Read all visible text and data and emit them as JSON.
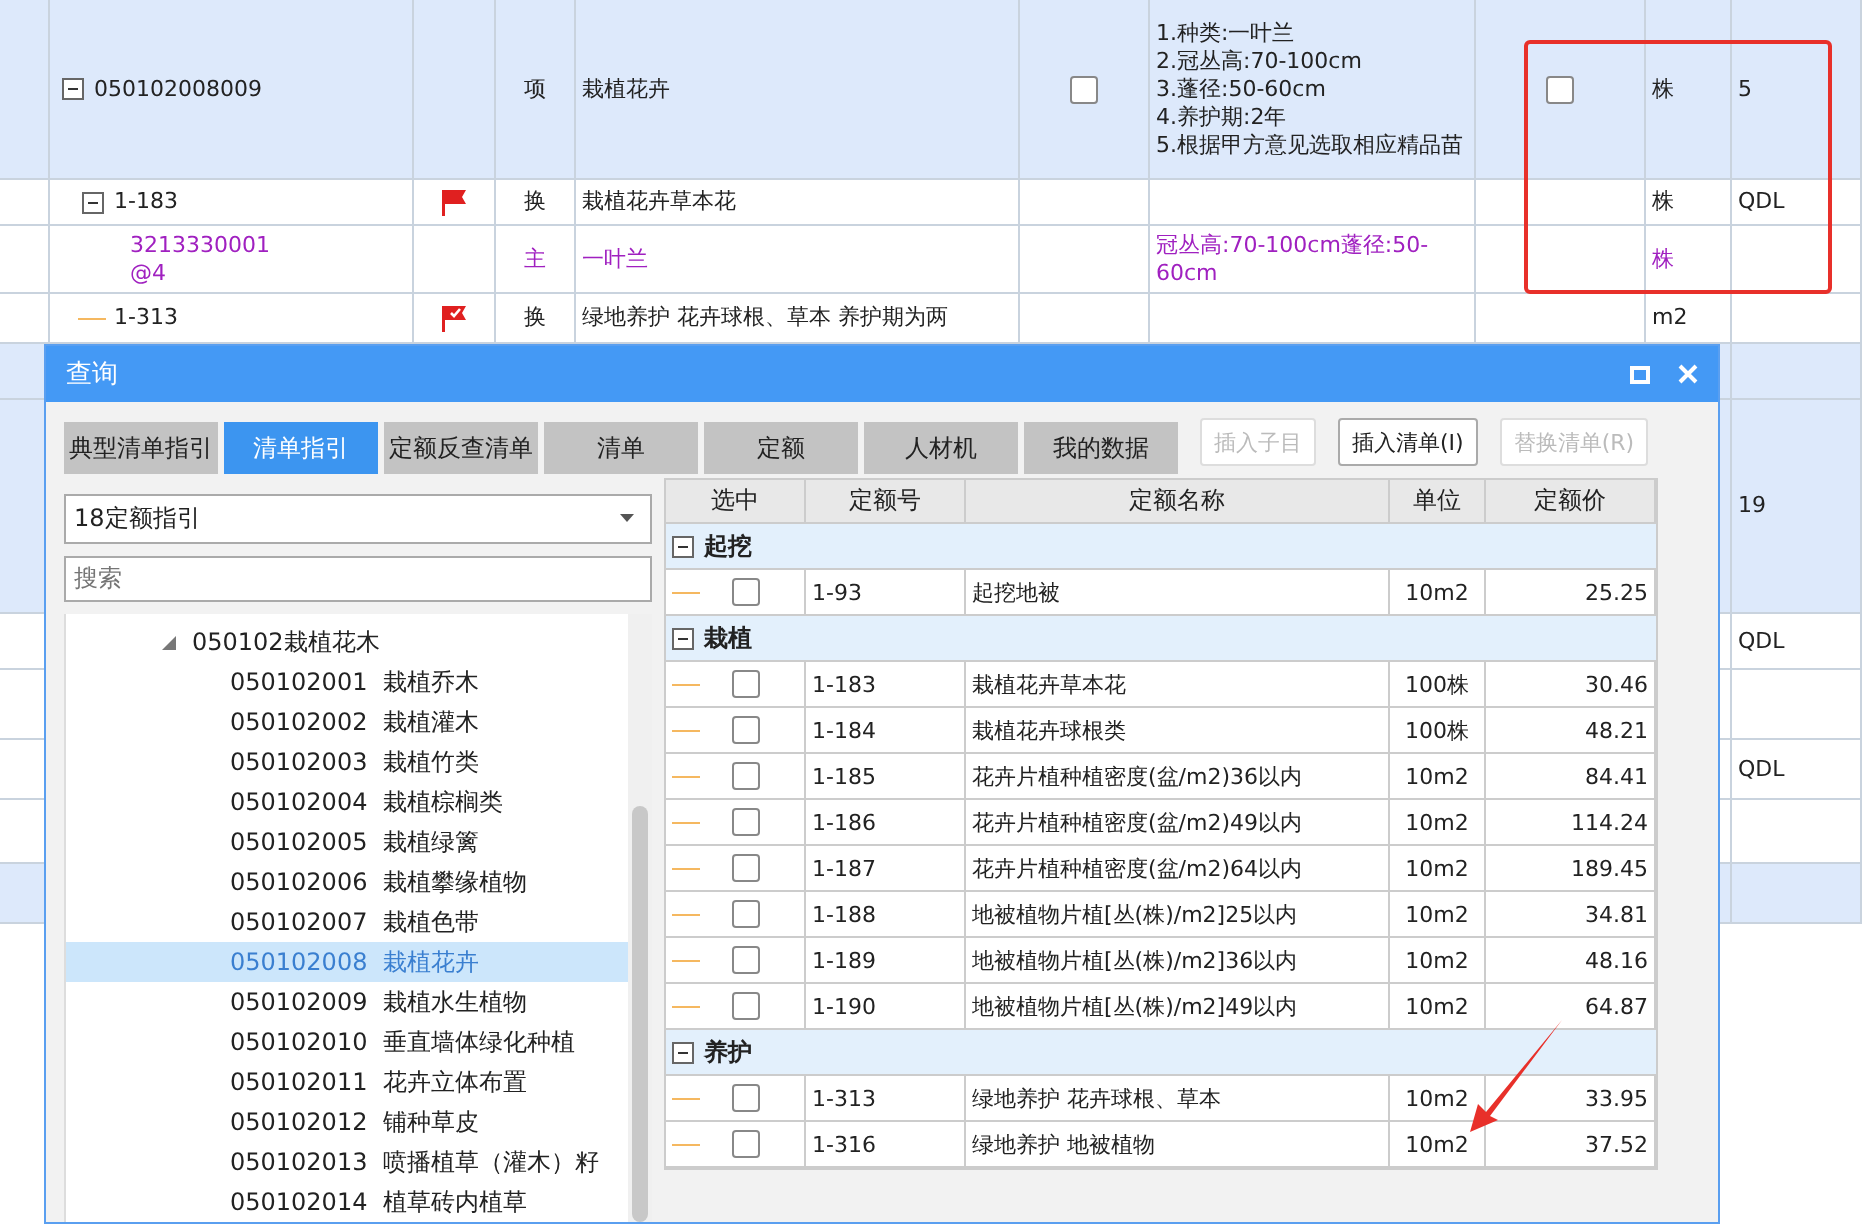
{
  "sheet": {
    "rows": [
      {
        "kind": "item",
        "code": "050102008009",
        "expanded": true,
        "type": "项",
        "name": "栽植花卉",
        "checked": false,
        "features": [
          "1.种类:一叶兰",
          "2.冠丛高:70-100cm",
          "3.蓬径:50-60cm",
          "4.养护期:2年",
          "5.根据甲方意见选取相应精品苗"
        ],
        "checked2": false,
        "unit": "株",
        "qty": "5"
      },
      {
        "kind": "sub",
        "code": "1-183",
        "expanded": true,
        "flagged": true,
        "flag_checked": false,
        "type": "换",
        "name": "栽植花卉草本花",
        "features": [],
        "unit": "株",
        "qty": "QDL"
      },
      {
        "kind": "main",
        "code": "3213330001@4",
        "type": "主",
        "name": "一叶兰",
        "features": [
          "冠丛高:70-100cm蓬径:50-60cm"
        ],
        "unit": "株",
        "qty": ""
      },
      {
        "kind": "sub",
        "code": "1-313",
        "flagged": true,
        "flag_checked": true,
        "type": "换",
        "name": "绿地养护 花卉球根、草本  养护期为两",
        "features": [],
        "unit": "m2",
        "qty": ""
      }
    ],
    "side_rows": [
      {
        "highlighted": true
      },
      {
        "value": "19",
        "highlighted": true
      },
      {
        "value": "QDL",
        "highlighted": false
      },
      {
        "highlighted": false
      },
      {
        "value": "QDL",
        "highlighted": false
      },
      {
        "highlighted": false
      },
      {
        "highlighted": true
      }
    ]
  },
  "dialog": {
    "title": "查询",
    "tabs": [
      {
        "label": "典型清单指引",
        "selected": false
      },
      {
        "label": "清单指引",
        "selected": true
      },
      {
        "label": "定额反查清单",
        "selected": false
      },
      {
        "label": "清单",
        "selected": false
      },
      {
        "label": "定额",
        "selected": false
      },
      {
        "label": "人材机",
        "selected": false
      },
      {
        "label": "我的数据",
        "selected": false
      }
    ],
    "buttons": [
      {
        "label": "插入子目",
        "disabled": true
      },
      {
        "label": "插入清单(I)",
        "disabled": false
      },
      {
        "label": "替换清单(R)",
        "disabled": true
      }
    ],
    "dropdown": "18定额指引",
    "search": {
      "placeholder": "搜索"
    },
    "tree": {
      "label": "050102栽植花木",
      "expanded": true,
      "children": [
        {
          "code": "050102001",
          "name": "栽植乔木",
          "selected": false
        },
        {
          "code": "050102002",
          "name": "栽植灌木",
          "selected": false
        },
        {
          "code": "050102003",
          "name": "栽植竹类",
          "selected": false
        },
        {
          "code": "050102004",
          "name": "栽植棕榈类",
          "selected": false
        },
        {
          "code": "050102005",
          "name": "栽植绿篱",
          "selected": false
        },
        {
          "code": "050102006",
          "name": "栽植攀缘植物",
          "selected": false
        },
        {
          "code": "050102007",
          "name": "栽植色带",
          "selected": false
        },
        {
          "code": "050102008",
          "name": "栽植花卉",
          "selected": true
        },
        {
          "code": "050102009",
          "name": "栽植水生植物",
          "selected": false
        },
        {
          "code": "050102010",
          "name": "垂直墙体绿化种植",
          "selected": false
        },
        {
          "code": "050102011",
          "name": "花卉立体布置",
          "selected": false
        },
        {
          "code": "050102012",
          "name": "铺种草皮",
          "selected": false
        },
        {
          "code": "050102013",
          "name": "喷播植草（灌木）籽",
          "selected": false
        },
        {
          "code": "050102014",
          "name": "植草砖内植草",
          "selected": false
        }
      ]
    },
    "columns": [
      "选中",
      "定额号",
      "定额名称",
      "单位",
      "定额价"
    ],
    "groups": [
      {
        "name": "起挖",
        "expanded": true,
        "rows": [
          {
            "code": "1-93",
            "name": "起挖地被",
            "unit": "10m2",
            "price": "25.25",
            "checked": false
          }
        ]
      },
      {
        "name": "栽植",
        "expanded": true,
        "rows": [
          {
            "code": "1-183",
            "name": "栽植花卉草本花",
            "unit": "100株",
            "price": "30.46",
            "checked": false
          },
          {
            "code": "1-184",
            "name": "栽植花卉球根类",
            "unit": "100株",
            "price": "48.21",
            "checked": false
          },
          {
            "code": "1-185",
            "name": "花卉片植种植密度(盆/m2)36以内",
            "unit": "10m2",
            "price": "84.41",
            "checked": false
          },
          {
            "code": "1-186",
            "name": "花卉片植种植密度(盆/m2)49以内",
            "unit": "10m2",
            "price": "114.24",
            "checked": false
          },
          {
            "code": "1-187",
            "name": "花卉片植种植密度(盆/m2)64以内",
            "unit": "10m2",
            "price": "189.45",
            "checked": false
          },
          {
            "code": "1-188",
            "name": "地被植物片植[丛(株)/m2]25以内",
            "unit": "10m2",
            "price": "34.81",
            "checked": false
          },
          {
            "code": "1-189",
            "name": "地被植物片植[丛(株)/m2]36以内",
            "unit": "10m2",
            "price": "48.16",
            "checked": false
          },
          {
            "code": "1-190",
            "name": "地被植物片植[丛(株)/m2]49以内",
            "unit": "10m2",
            "price": "64.87",
            "checked": false
          }
        ]
      },
      {
        "name": "养护",
        "expanded": true,
        "rows": [
          {
            "code": "1-313",
            "name": "绿地养护 花卉球根、草本",
            "unit": "10m2",
            "price": "33.95",
            "checked": false
          },
          {
            "code": "1-316",
            "name": "绿地养护 地被植物",
            "unit": "10m2",
            "price": "37.52",
            "checked": false
          }
        ]
      }
    ]
  }
}
